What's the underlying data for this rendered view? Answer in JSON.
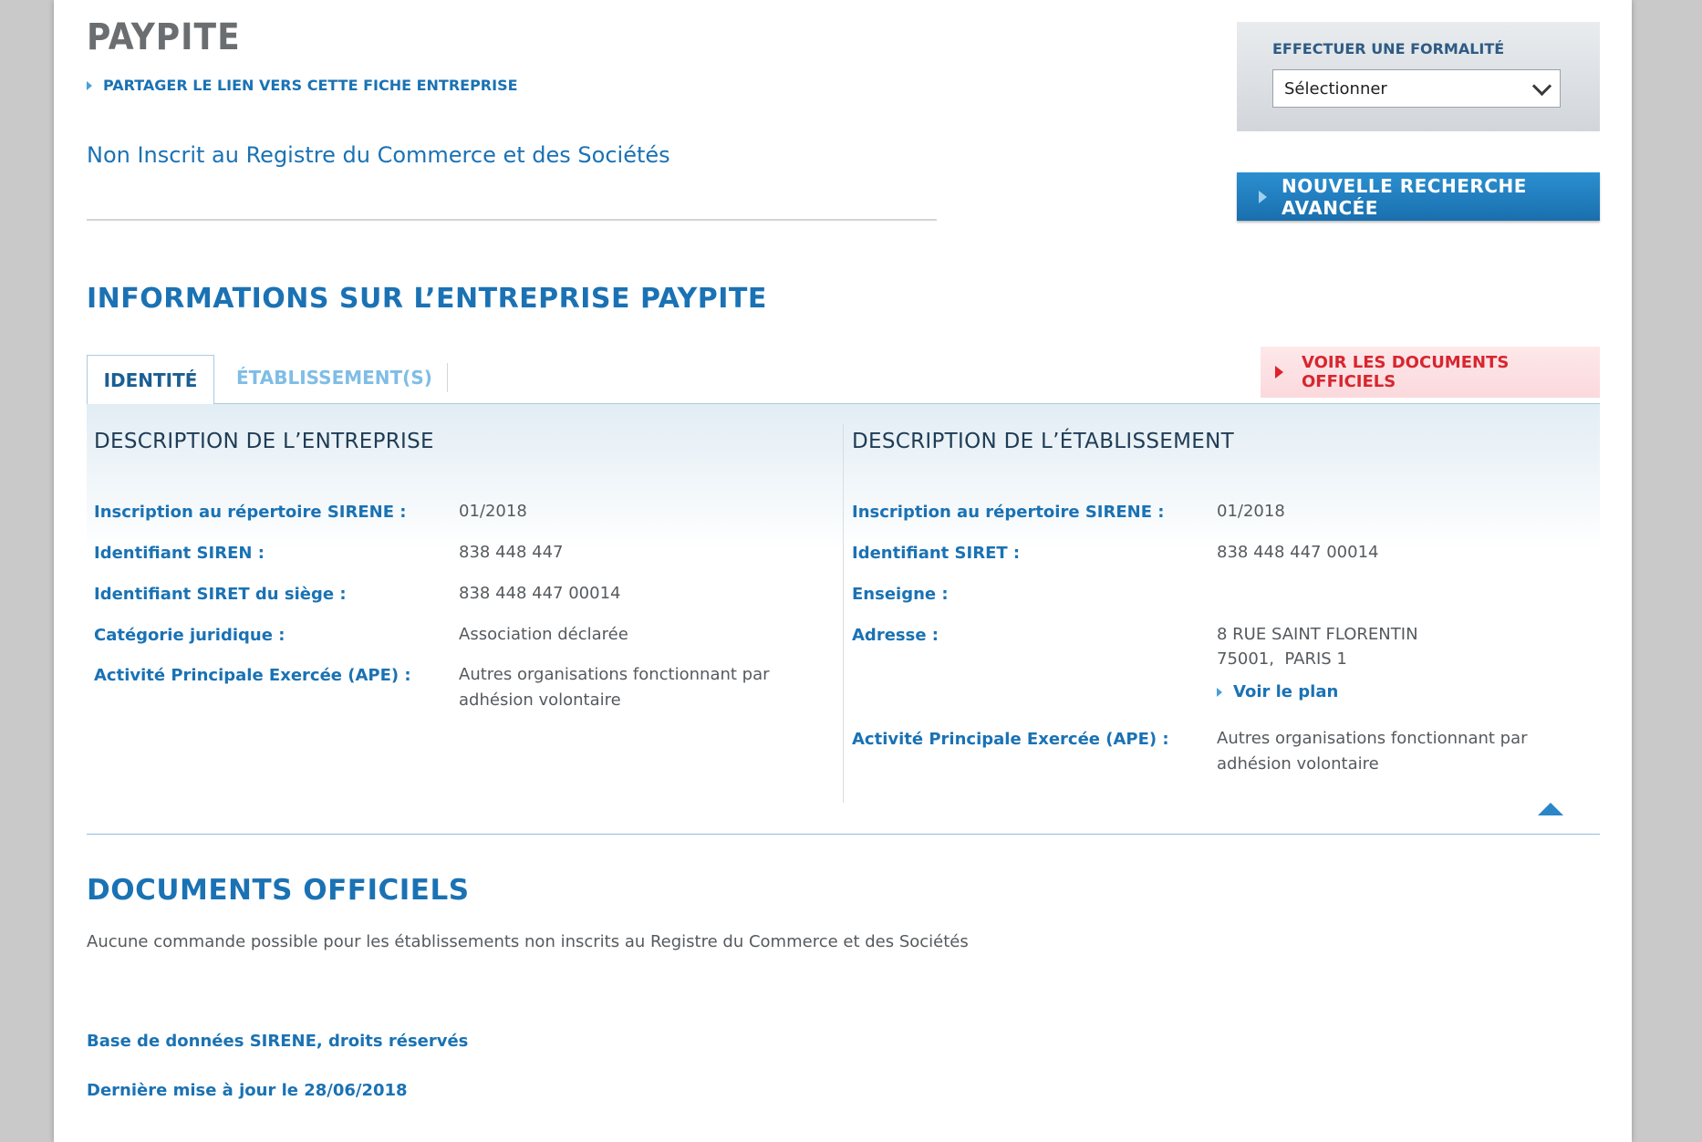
{
  "header": {
    "company_name": "PAYPITE",
    "share_link": "PARTAGER LE LIEN VERS CETTE FICHE ENTREPRISE",
    "registration_status": "Non Inscrit au Registre du Commerce et des Sociétés"
  },
  "formality": {
    "label": "EFFECTUER UNE FORMALITÉ",
    "select_value": "Sélectionner"
  },
  "advanced_search": {
    "label": "NOUVELLE RECHERCHE AVANCÉE"
  },
  "info_title": "INFORMATIONS SUR L’ENTREPRISE PAYPITE",
  "tabs": {
    "identity": "IDENTITÉ",
    "establishments": "ÉTABLISSEMENT(S)",
    "official_docs_button": "VOIR LES DOCUMENTS OFFICIELS"
  },
  "company_description": {
    "title": "DESCRIPTION DE L’ENTREPRISE",
    "rows": [
      {
        "label": "Inscription au répertoire SIRENE :",
        "value": "01/2018"
      },
      {
        "label": "Identifiant SIREN :",
        "value": "838 448 447"
      },
      {
        "label": "Identifiant SIRET du siège :",
        "value": "838 448 447 00014"
      },
      {
        "label": "Catégorie juridique :",
        "value": "Association déclarée"
      },
      {
        "label": "Activité Principale Exercée (APE) :",
        "value": "Autres organisations fonctionnant par adhésion volontaire"
      }
    ]
  },
  "establishment_description": {
    "title": "DESCRIPTION DE L’ÉTABLISSEMENT",
    "rows": [
      {
        "label": "Inscription au répertoire SIRENE :",
        "value": "01/2018"
      },
      {
        "label": "Identifiant SIRET :",
        "value": "838 448 447 00014"
      },
      {
        "label": "Enseigne :",
        "value": ""
      },
      {
        "label": "Adresse :",
        "value": "8 RUE SAINT FLORENTIN"
      },
      {
        "label": "Activité Principale Exercée (APE) :",
        "value": "Autres organisations fonctionnant par adhésion volontaire"
      }
    ],
    "address_line2": "75001,  PARIS 1",
    "map_link": "Voir le plan"
  },
  "official_documents": {
    "title": "DOCUMENTS OFFICIELS",
    "text": "Aucune commande possible pour les établissements non inscrits au Registre du Commerce et des Sociétés"
  },
  "footer": {
    "rights": "Base de données SIRENE, droits réservés",
    "last_update": "Dernière mise à jour le 28/06/2018"
  },
  "colors": {
    "brand_blue": "#1a72b4",
    "docs_red": "#d7262e",
    "title_grey": "#6b6e70"
  }
}
